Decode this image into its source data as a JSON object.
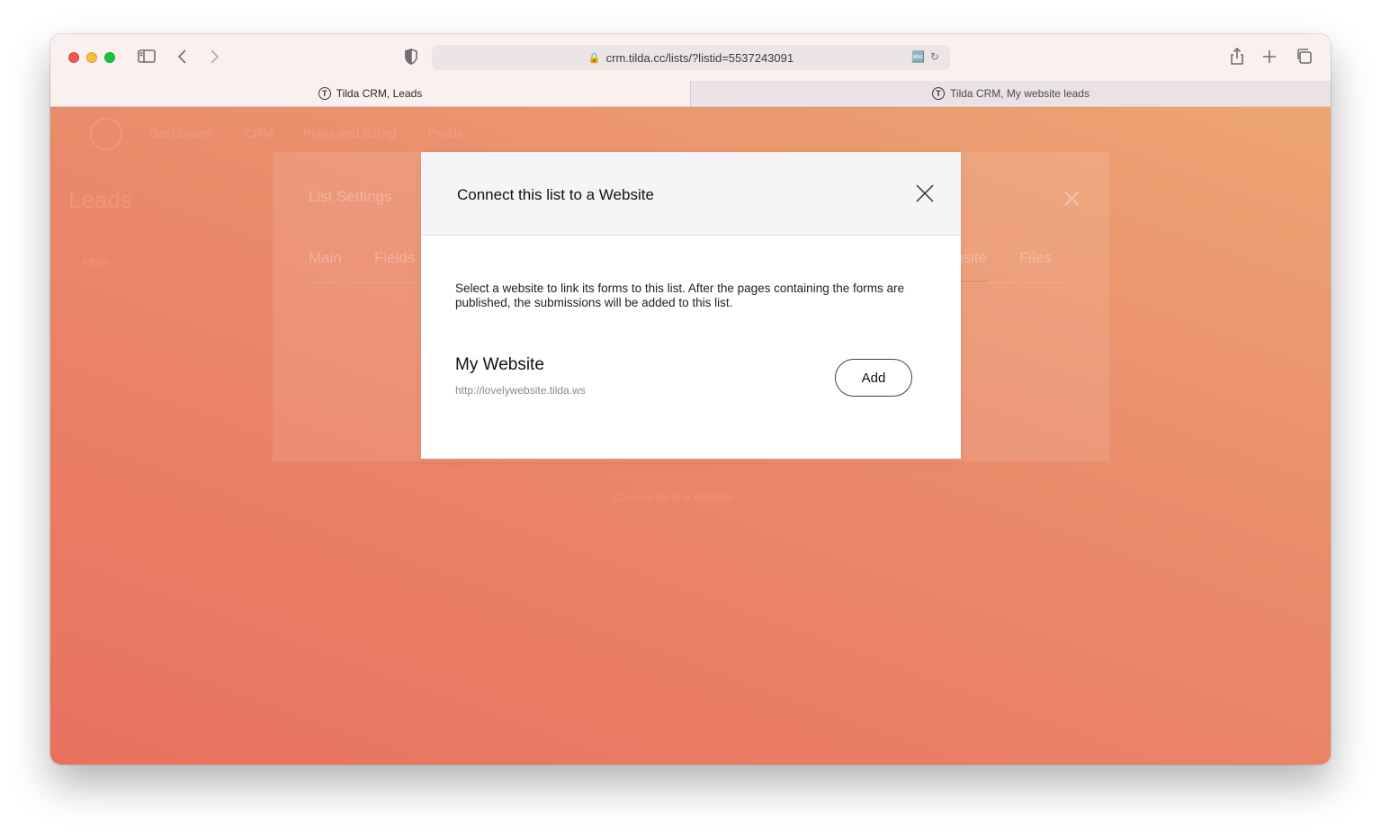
{
  "browser": {
    "address": "crm.tilda.cc/lists/?listid=5537243091",
    "tabs": [
      {
        "label": "Tilda CRM, Leads",
        "active": true
      },
      {
        "label": "Tilda CRM, My website leads",
        "active": false
      }
    ],
    "favicon_letter": "T"
  },
  "background_app": {
    "nav": [
      "Dashboard",
      "CRM",
      "Plans and Billing",
      "Profile"
    ],
    "page_title": "Leads",
    "inbox_label": "Inbox",
    "footer_text": "Connect list to a Website"
  },
  "settings_panel": {
    "title": "List Settings",
    "tabs": [
      "Main",
      "Fields",
      "Website",
      "Files"
    ],
    "active_tab": "Website"
  },
  "modal": {
    "title": "Connect this list to a Website",
    "description": "Select a website to link its forms to this list. After the pages containing the forms are published, the submissions will be added to this list.",
    "site_name": "My Website",
    "site_url": "http://lovelywebsite.tilda.ws",
    "add_label": "Add"
  },
  "colors": {
    "gradient_start": "#e9715f",
    "gradient_end": "#eca574",
    "toolbar_bg": "#fbf0f0"
  }
}
